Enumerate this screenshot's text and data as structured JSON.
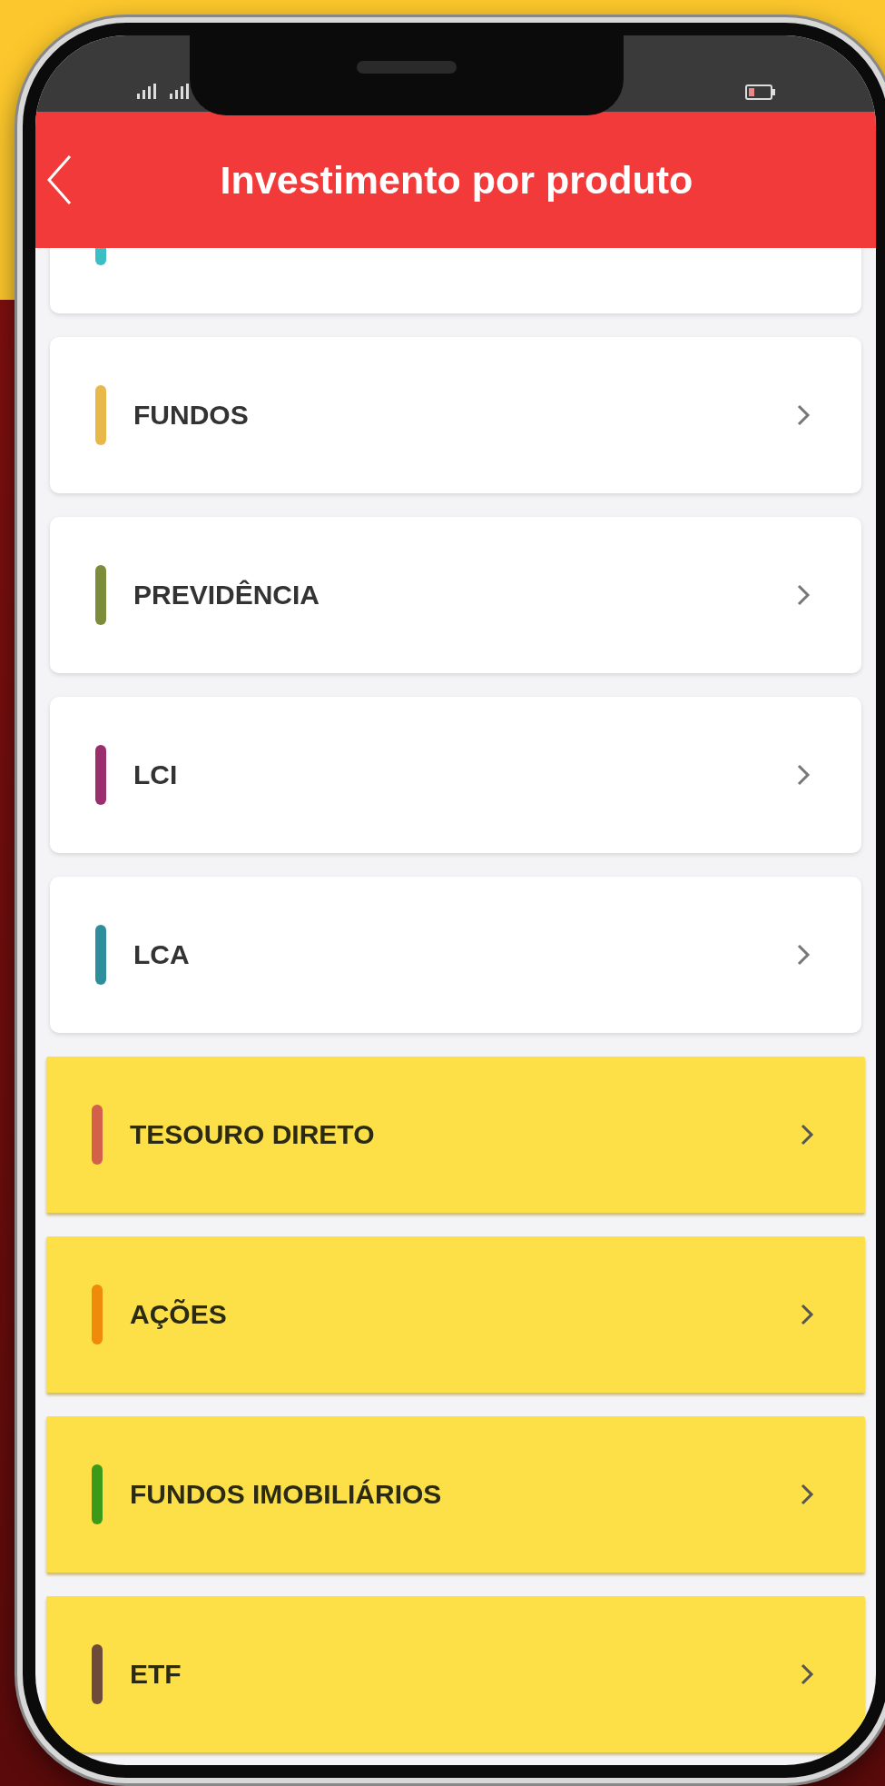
{
  "header": {
    "title": "Investimento por produto"
  },
  "products": [
    {
      "color": "#3bbfc4",
      "highlighted": false
    },
    {
      "label": "FUNDOS",
      "color": "#e8b84a",
      "highlighted": false
    },
    {
      "label": "PREVIDÊNCIA",
      "color": "#7d8c3a",
      "highlighted": false
    },
    {
      "label": "LCI",
      "color": "#9b2f6e",
      "highlighted": false
    },
    {
      "label": "LCA",
      "color": "#2f8e9b",
      "highlighted": false
    },
    {
      "label": "TESOURO DIRETO",
      "color": "#d2604a",
      "highlighted": true
    },
    {
      "label": "AÇÕES",
      "color": "#ef8a0a",
      "highlighted": true
    },
    {
      "label": "FUNDOS IMOBILIÁRIOS",
      "color": "#3c9a1a",
      "highlighted": true
    },
    {
      "label": "ETF",
      "color": "#6e4a3a",
      "highlighted": true
    }
  ]
}
